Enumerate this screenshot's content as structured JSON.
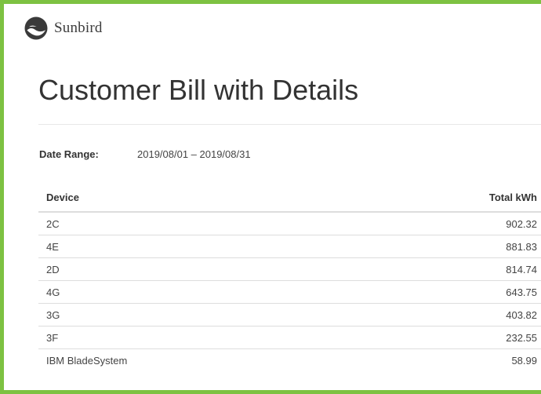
{
  "brand": {
    "name": "Sunbird",
    "logo_icon": "sunbird-bird-logo-icon",
    "accent_color": "#7dc242"
  },
  "page": {
    "title": "Customer Bill with Details"
  },
  "date_range": {
    "label": "Date Range:",
    "value": "2019/08/01 – 2019/08/31"
  },
  "table": {
    "columns": [
      "Device",
      "Total kWh"
    ],
    "rows": [
      {
        "device": "2C",
        "total_kwh": "902.32"
      },
      {
        "device": "4E",
        "total_kwh": "881.83"
      },
      {
        "device": "2D",
        "total_kwh": "814.74"
      },
      {
        "device": "4G",
        "total_kwh": "643.75"
      },
      {
        "device": "3G",
        "total_kwh": "403.82"
      },
      {
        "device": "3F",
        "total_kwh": "232.55"
      },
      {
        "device": "IBM BladeSystem",
        "total_kwh": "58.99"
      }
    ]
  }
}
